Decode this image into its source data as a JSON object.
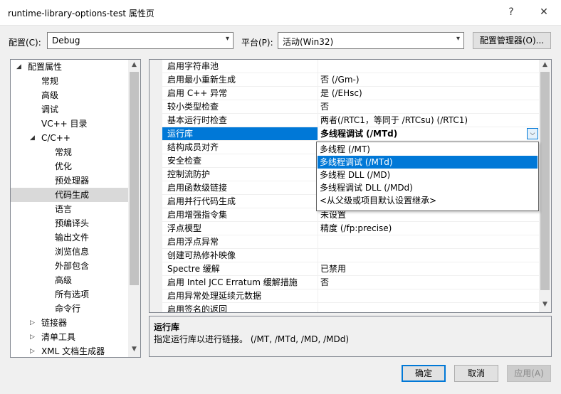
{
  "window": {
    "title": "runtime-library-options-test 属性页",
    "help_glyph": "?",
    "close_glyph": "✕"
  },
  "toolbar": {
    "config_label": "配置(C):",
    "config_value": "Debug",
    "platform_label": "平台(P):",
    "platform_value": "活动(Win32)",
    "config_manager_label": "配置管理器(O)..."
  },
  "tree": {
    "items": [
      {
        "label": "配置属性",
        "expander": "◢"
      },
      {
        "label": "常规",
        "expander": ""
      },
      {
        "label": "高级",
        "expander": ""
      },
      {
        "label": "调试",
        "expander": ""
      },
      {
        "label": "VC++ 目录",
        "expander": ""
      },
      {
        "label": "C/C++",
        "expander": "◢"
      },
      {
        "label": "常规",
        "expander": ""
      },
      {
        "label": "优化",
        "expander": ""
      },
      {
        "label": "预处理器",
        "expander": ""
      },
      {
        "label": "代码生成",
        "expander": ""
      },
      {
        "label": "语言",
        "expander": ""
      },
      {
        "label": "预编译头",
        "expander": ""
      },
      {
        "label": "输出文件",
        "expander": ""
      },
      {
        "label": "浏览信息",
        "expander": ""
      },
      {
        "label": "外部包含",
        "expander": ""
      },
      {
        "label": "高级",
        "expander": ""
      },
      {
        "label": "所有选项",
        "expander": ""
      },
      {
        "label": "命令行",
        "expander": ""
      },
      {
        "label": "链接器",
        "expander": "▷"
      },
      {
        "label": "清单工具",
        "expander": "▷"
      },
      {
        "label": "XML 文档生成器",
        "expander": "▷"
      }
    ],
    "selected": "代码生成"
  },
  "grid": {
    "rows": [
      {
        "name": "启用字符串池",
        "value": ""
      },
      {
        "name": "启用最小重新生成",
        "value": "否 (/Gm-)"
      },
      {
        "name": "启用 C++ 异常",
        "value": "是 (/EHsc)"
      },
      {
        "name": "较小类型检查",
        "value": "否"
      },
      {
        "name": "基本运行时检查",
        "value": "两者(/RTC1，等同于 /RTCsu) (/RTC1)"
      },
      {
        "name": "运行库",
        "value": "多线程调试 (/MTd)"
      },
      {
        "name": "结构成员对齐",
        "value": ""
      },
      {
        "name": "安全检查",
        "value": ""
      },
      {
        "name": "控制流防护",
        "value": ""
      },
      {
        "name": "启用函数级链接",
        "value": ""
      },
      {
        "name": "启用并行代码生成",
        "value": ""
      },
      {
        "name": "启用增强指令集",
        "value": "未设置"
      },
      {
        "name": "浮点模型",
        "value": "精度 (/fp:precise)"
      },
      {
        "name": "启用浮点异常",
        "value": ""
      },
      {
        "name": "创建可热修补映像",
        "value": ""
      },
      {
        "name": "Spectre 缓解",
        "value": "已禁用"
      },
      {
        "name": "启用 Intel JCC Erratum 缓解措施",
        "value": "否"
      },
      {
        "name": "启用异常处理延续元数据",
        "value": ""
      },
      {
        "name": "启用签名的返回",
        "value": ""
      }
    ],
    "selected_row": "运行库"
  },
  "dropdown": {
    "options": [
      "多线程 (/MT)",
      "多线程调试 (/MTd)",
      "多线程 DLL (/MD)",
      "多线程调试 DLL (/MDd)",
      "<从父级或项目默认设置继承>"
    ],
    "selected": "多线程调试 (/MTd)"
  },
  "description": {
    "title": "运行库",
    "text": "指定运行库以进行链接。    (/MT, /MTd, /MD, /MDd)"
  },
  "buttons": {
    "ok": "确定",
    "cancel": "取消",
    "apply": "应用(A)"
  },
  "colors": {
    "accent": "#0078d7",
    "tree_selected": "#d9d9d9"
  }
}
